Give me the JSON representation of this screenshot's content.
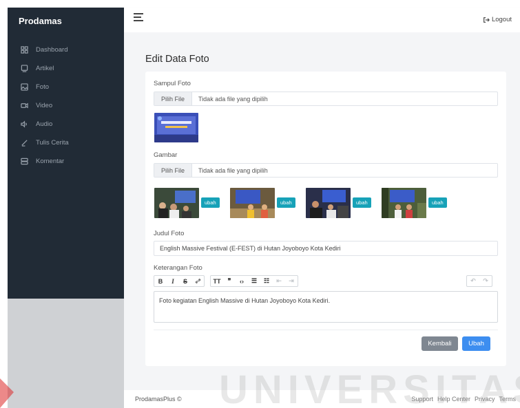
{
  "sidebar": {
    "brand": "Prodamas",
    "items": [
      {
        "label": "Dashboard",
        "icon": "dashboard-icon"
      },
      {
        "label": "Artikel",
        "icon": "tablet-icon"
      },
      {
        "label": "Foto",
        "icon": "image-icon"
      },
      {
        "label": "Video",
        "icon": "video-icon"
      },
      {
        "label": "Audio",
        "icon": "volume-icon"
      },
      {
        "label": "Tulis Cerita",
        "icon": "pen-icon"
      },
      {
        "label": "Komentar",
        "icon": "database-icon"
      }
    ]
  },
  "topbar": {
    "logout_label": "Logout"
  },
  "page": {
    "title": "Edit Data Foto",
    "cover": {
      "label": "Sampul Foto",
      "button": "Pilih File",
      "status": "Tidak ada file yang dipilih"
    },
    "images": {
      "label": "Gambar",
      "button": "Pilih File",
      "status": "Tidak ada file yang dipilih",
      "change_label": "ubah"
    },
    "title_field": {
      "label": "Judul Foto",
      "value": "English Massive Festival (E-FEST) di Hutan Joyoboyo Kota Kediri"
    },
    "description": {
      "label": "Keterangan Foto",
      "value": "Foto kegiatan English Massive di Hutan Joyoboyo Kota Kediri."
    },
    "buttons": {
      "back": "Kembali",
      "save": "Ubah"
    }
  },
  "footer": {
    "brand": "ProdamasPlus ©",
    "links": [
      "Support",
      "Help Center",
      "Privacy",
      "Terms"
    ]
  },
  "watermark": "UNIVERSITAS",
  "colors": {
    "sidebar": "#212b36",
    "accent": "#3d8ef0",
    "info": "#17a2b8",
    "muted": "#7f8791"
  }
}
